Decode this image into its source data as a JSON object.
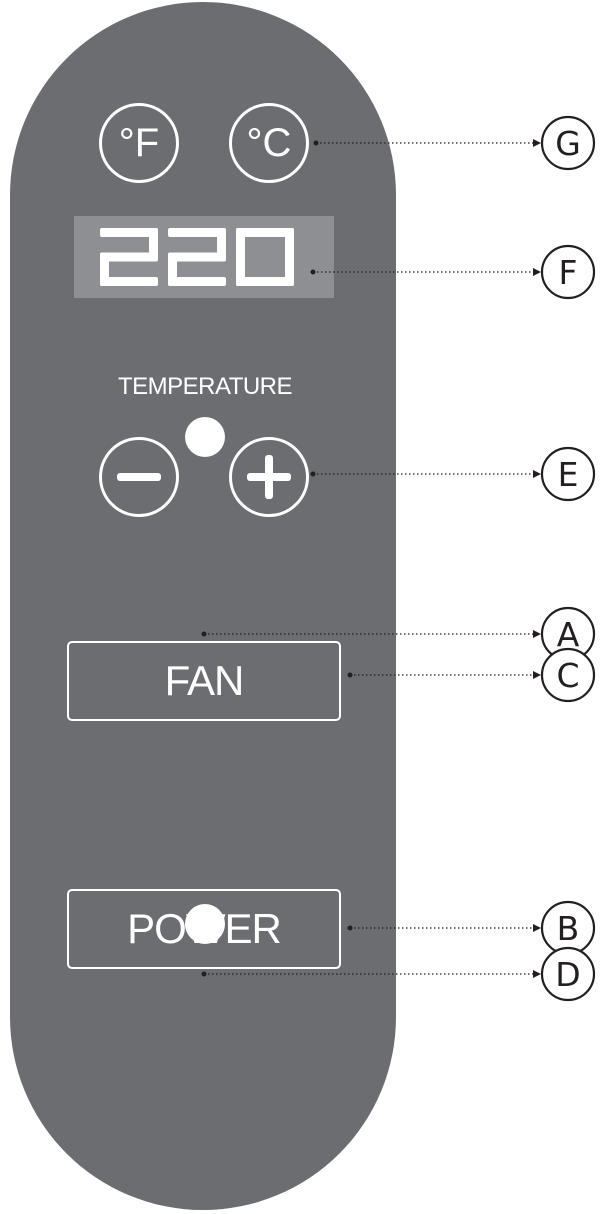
{
  "display": {
    "value": "220"
  },
  "controls": {
    "fahrenheit_label": "°F",
    "celsius_label": "°C",
    "temperature_label": "TEMPERATURE",
    "fan_label": "FAN",
    "power_label": "POWER"
  },
  "callouts": {
    "g": "G",
    "f": "F",
    "e": "E",
    "a": "A",
    "c": "C",
    "b": "B",
    "d": "D"
  },
  "colors": {
    "panel": "#6c6d71",
    "display_background": "#8e8f93",
    "foreground": "#ffffff",
    "callout": "#231f20"
  }
}
